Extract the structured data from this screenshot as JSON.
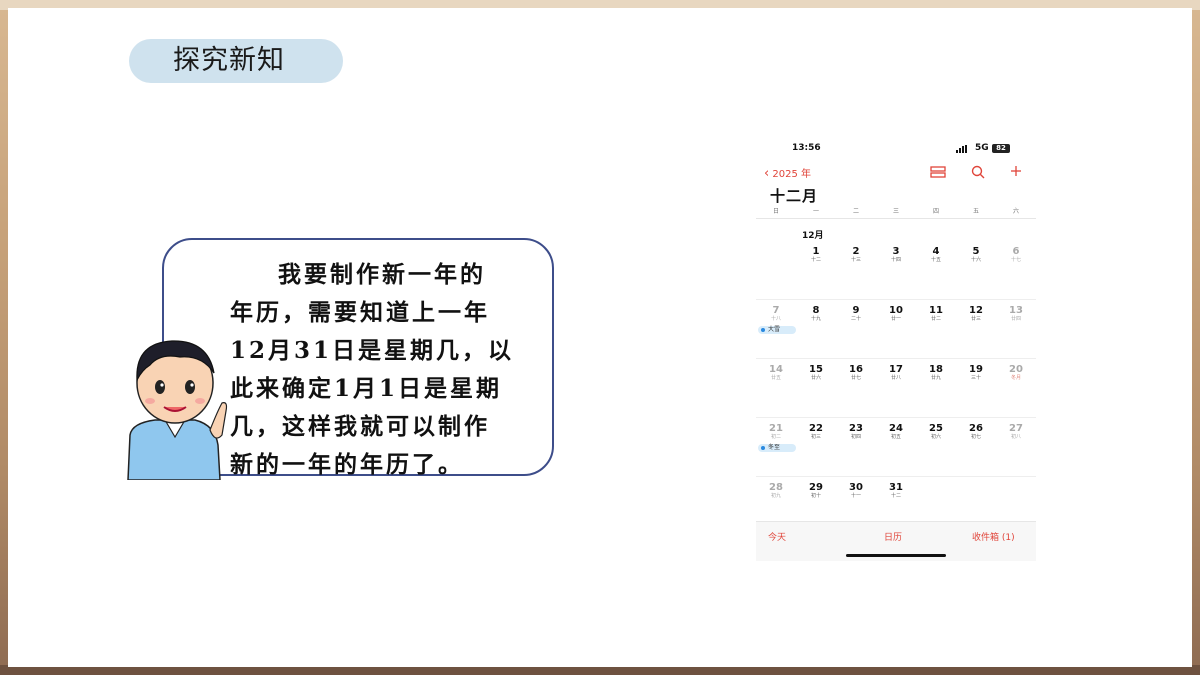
{
  "section_tag": "探究新知",
  "speech": {
    "lines": [
      "我要制作新一年的",
      "年历，需要知道上一年",
      "12月31日是星期几，以",
      "此来确定1月1日是星期",
      "几，这样我就可以制作",
      "新的一年的年历了。"
    ]
  },
  "phone": {
    "status": {
      "time": "13:56",
      "network": "5G",
      "battery": "82"
    },
    "nav": {
      "back_label": "2025 年",
      "icons": [
        "calendar-list-icon",
        "search-icon",
        "add-icon"
      ]
    },
    "month_title": "十二月",
    "weekdays": [
      "日",
      "一",
      "二",
      "三",
      "四",
      "五",
      "六"
    ],
    "grid_month_label": "12月",
    "weeks": [
      [
        null,
        {
          "d": "1",
          "l": "十二"
        },
        {
          "d": "2",
          "l": "十三"
        },
        {
          "d": "3",
          "l": "十四"
        },
        {
          "d": "4",
          "l": "十五"
        },
        {
          "d": "5",
          "l": "十六"
        },
        {
          "d": "6",
          "l": "十七"
        }
      ],
      [
        {
          "d": "7",
          "l": "十八"
        },
        {
          "d": "8",
          "l": "十九"
        },
        {
          "d": "9",
          "l": "二十"
        },
        {
          "d": "10",
          "l": "廿一"
        },
        {
          "d": "11",
          "l": "廿二"
        },
        {
          "d": "12",
          "l": "廿三"
        },
        {
          "d": "13",
          "l": "廿四"
        }
      ],
      [
        {
          "d": "14",
          "l": "廿五"
        },
        {
          "d": "15",
          "l": "廿六"
        },
        {
          "d": "16",
          "l": "廿七"
        },
        {
          "d": "17",
          "l": "廿八"
        },
        {
          "d": "18",
          "l": "廿九"
        },
        {
          "d": "19",
          "l": "三十"
        },
        {
          "d": "20",
          "l": "冬月"
        }
      ],
      [
        {
          "d": "21",
          "l": "初二"
        },
        {
          "d": "22",
          "l": "初三"
        },
        {
          "d": "23",
          "l": "初四"
        },
        {
          "d": "24",
          "l": "初五"
        },
        {
          "d": "25",
          "l": "初六"
        },
        {
          "d": "26",
          "l": "初七"
        },
        {
          "d": "27",
          "l": "初八"
        }
      ],
      [
        {
          "d": "28",
          "l": "初九"
        },
        {
          "d": "29",
          "l": "初十"
        },
        {
          "d": "30",
          "l": "十一"
        },
        {
          "d": "31",
          "l": "十二"
        },
        null,
        null,
        null
      ]
    ],
    "events": [
      {
        "week": 1,
        "label": "大雪"
      },
      {
        "week": 3,
        "label": "冬至"
      }
    ],
    "tabs": {
      "today": "今天",
      "calendar": "日历",
      "inbox": "收件箱 (1)"
    },
    "accent": "#e0453a"
  }
}
